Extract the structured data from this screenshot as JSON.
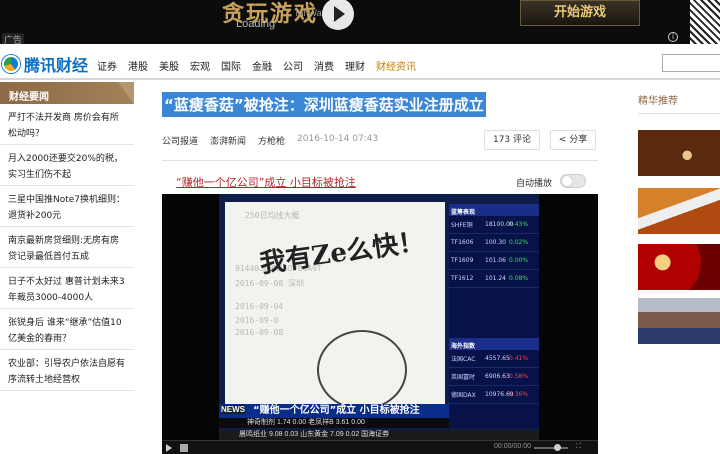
{
  "ad": {
    "logo_text": "贪玩游戏",
    "logo_small": "TanWan.com",
    "loading": "Loading",
    "start_button": "开始游戏",
    "tag": "广告"
  },
  "header": {
    "site_name": "腾讯财经",
    "nav": [
      "证券",
      "港股",
      "美股",
      "宏观",
      "国际",
      "金融",
      "公司",
      "消费",
      "理财",
      "财经资讯"
    ],
    "active_nav": "财经资讯"
  },
  "sidebar": {
    "title": "财经要闻",
    "items": [
      "严打不法开发商 房价会有所松动吗？",
      "月入2000还要交20%的税，实习生们伤不起",
      "三星中国推Note7换机细则：退货补200元",
      "南京最新房贷细则:无房有房贷记录最低首付五成",
      "日子不太好过 惠普计划未来3年裁员3000-4000人",
      "张锐身后 谁来“继承”估值10亿美金的春雨？",
      "农业部：引导农户依法自愿有序流转土地经营权"
    ]
  },
  "article": {
    "title": "“蓝瘦香菇”被抢注：深圳蓝瘦香菇实业注册成立",
    "source": "公司报道",
    "outlet": "澎湃新闻",
    "author": "方枪枪",
    "time": "2016-10-14 07:43",
    "comments": "173 评论",
    "share": "分享",
    "related_link": "“赚他一个亿公司”成立 小目标被抢注",
    "autoplay_label": "自动播放"
  },
  "video": {
    "handwriting": "我有Ze么快！",
    "news_logo": "NEWS",
    "news_headline": "“赚他一个亿公司”成立 小目标被抢注",
    "ticker_header": "蓝筹表现",
    "ticker_rows": [
      {
        "name": "SHFE铜",
        "value": "18100.00",
        "change": "0.43%",
        "up": true
      },
      {
        "name": "TF1606",
        "value": "100.30",
        "change": "0.02%",
        "up": true
      },
      {
        "name": "TF1609",
        "value": "101.06",
        "change": "0.00%",
        "up": true
      },
      {
        "name": "TF1612",
        "value": "101.24",
        "change": "0.08%",
        "up": true
      }
    ],
    "ticker_header2": "海外指数",
    "ticker_rows2": [
      {
        "name": "法国CAC",
        "value": "4557.65",
        "change": "0.41%",
        "up": false
      },
      {
        "name": "英国富时",
        "value": "6906.63",
        "change": "0.58%",
        "up": false
      },
      {
        "name": "德国DAX",
        "value": "10976.69",
        "change": "0.36%",
        "up": false
      }
    ],
    "sub_line": "神奇制剂  1.74 0.00      老凤祥B  3.61 0.00",
    "sub_line2": "晨鸣纸业 9.08  0.03    山东黄金 7.09  0.02    国海证券",
    "time": "00:00/00:00"
  },
  "right": {
    "title": "精华推荐"
  }
}
